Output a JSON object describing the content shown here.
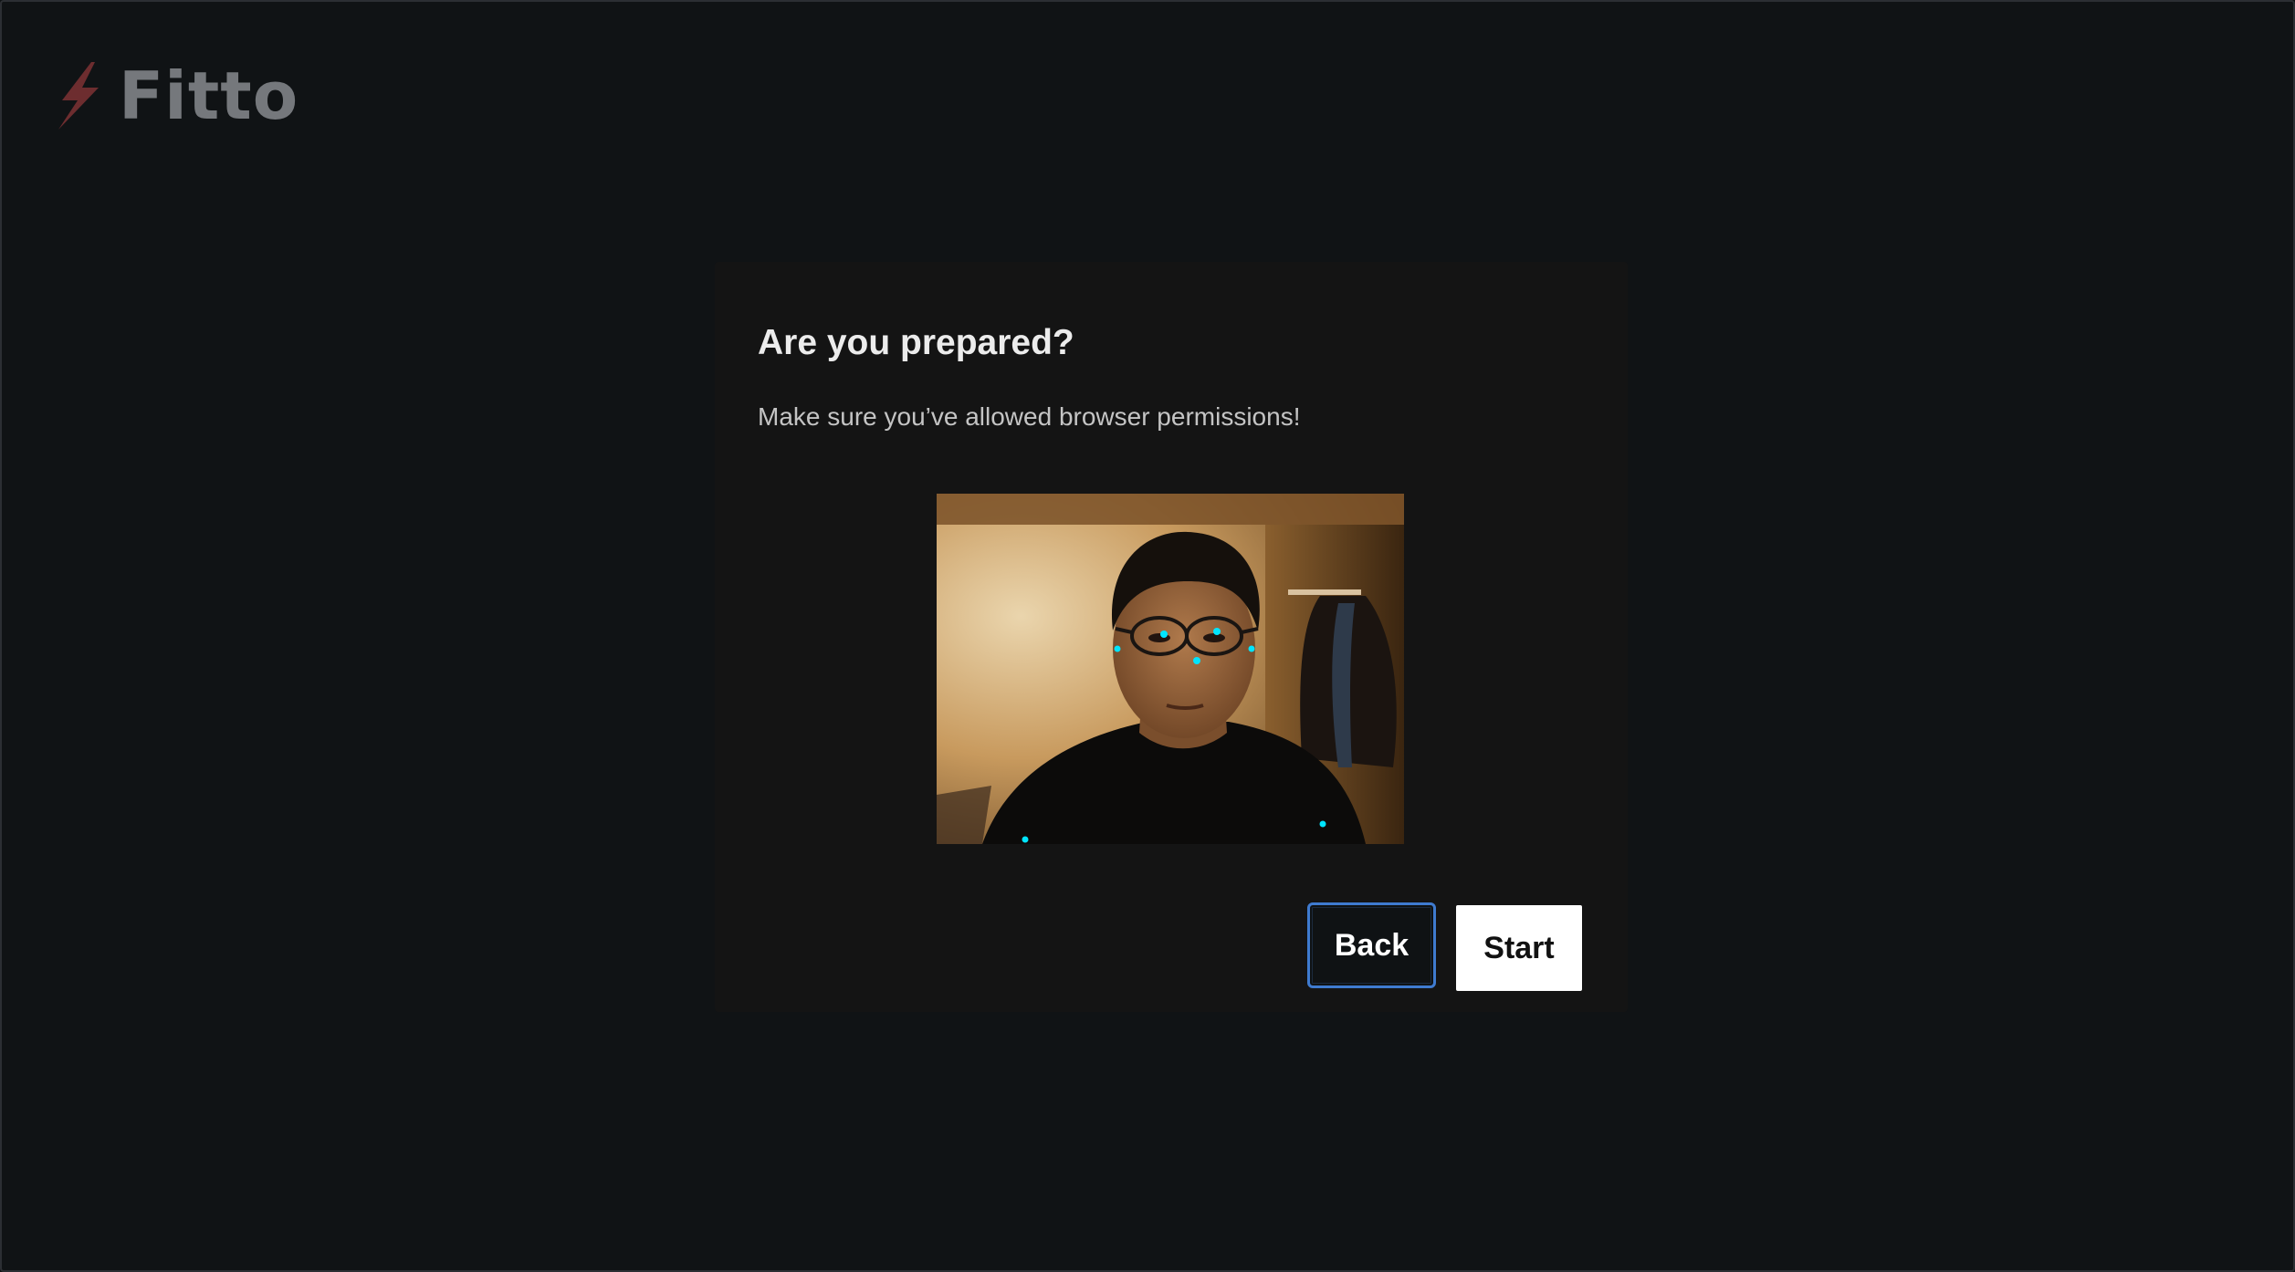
{
  "app": {
    "logo_text": "Fitto",
    "logo_icon": "lightning-bolt-icon",
    "brand_color": "#7a3133"
  },
  "dialog": {
    "title": "Are you prepared?",
    "subtitle": "Make sure you’ve allowed browser permissions!",
    "webcam_feed": {
      "icon": "webcam-feed",
      "keypoint_color": "#00e5ff"
    },
    "buttons": {
      "back_label": "Back",
      "start_label": "Start"
    }
  }
}
